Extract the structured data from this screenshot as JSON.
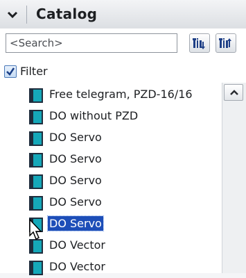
{
  "panel": {
    "title": "Catalog"
  },
  "search": {
    "placeholder": "<Search>",
    "value": ""
  },
  "filter": {
    "label": "Filter",
    "checked": true
  },
  "items": [
    {
      "label": "Free telegram, PZD-16/16",
      "selected": false
    },
    {
      "label": "DO without PZD",
      "selected": false
    },
    {
      "label": "DO Servo",
      "selected": false
    },
    {
      "label": "DO Servo",
      "selected": false
    },
    {
      "label": "DO Servo",
      "selected": false
    },
    {
      "label": "DO Servo",
      "selected": false
    },
    {
      "label": "DO Servo",
      "selected": true
    },
    {
      "label": "DO Vector",
      "selected": false
    },
    {
      "label": "DO Vector",
      "selected": false
    }
  ],
  "colors": {
    "selection": "#1d4eb8",
    "module_icon_dark": "#1f2d3d",
    "module_icon_teal": "#15a8b9"
  },
  "icons": {
    "collapse": "chevron-down-icon",
    "search_down": "search-down-icon",
    "search_up": "search-up-icon",
    "scroll_up": "chevron-up-icon",
    "module": "module-icon",
    "cursor": "mouse-cursor-icon"
  }
}
